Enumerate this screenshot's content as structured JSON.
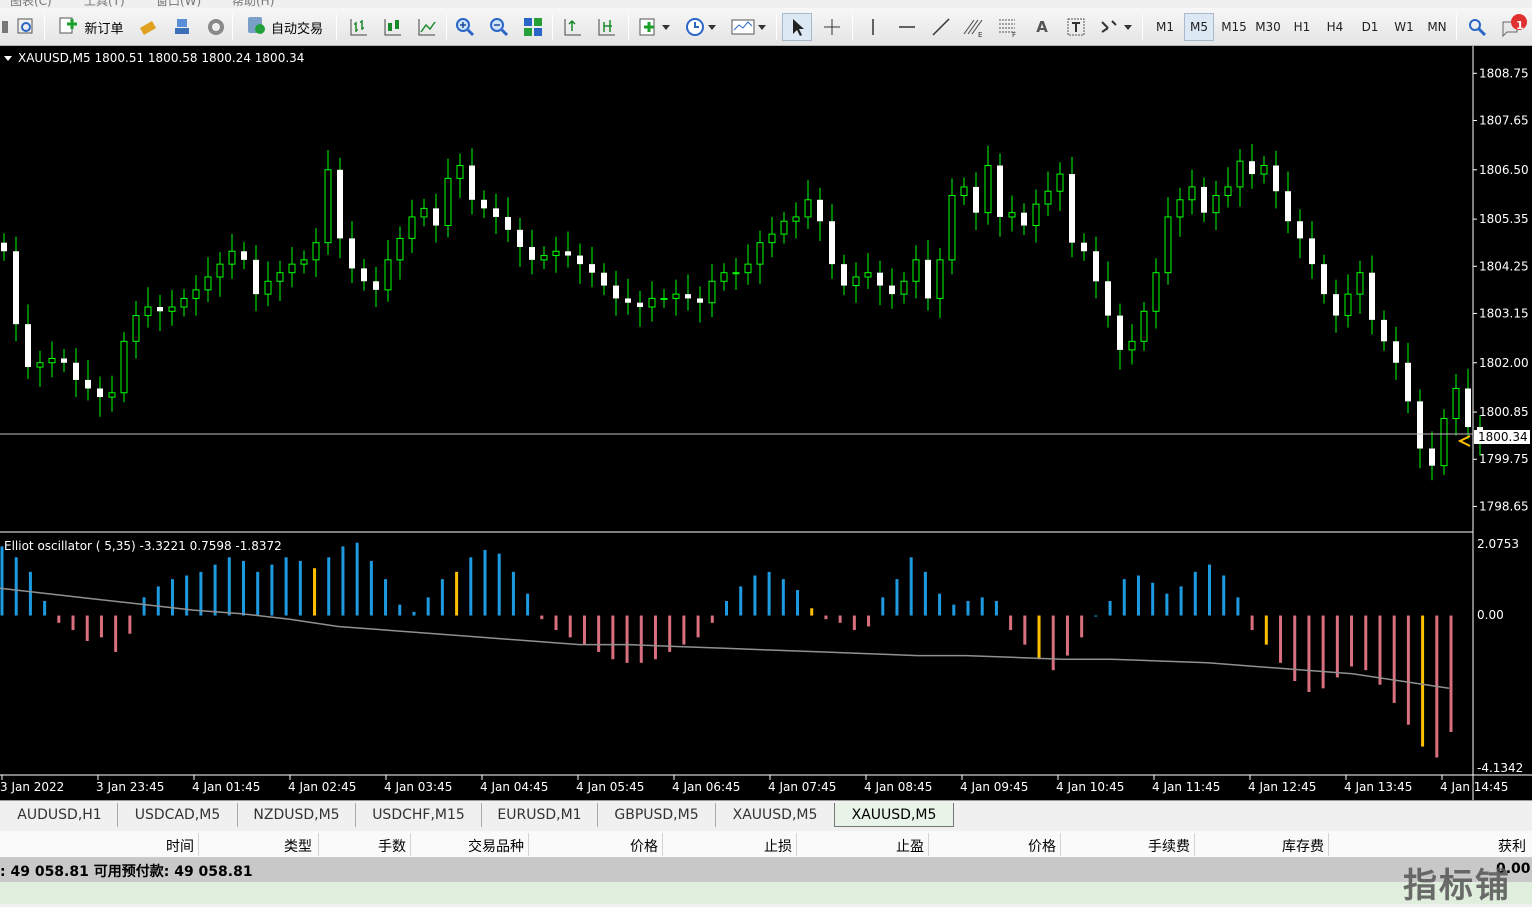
{
  "menu": [
    "图表(C)",
    "工具(T)",
    "窗口(W)",
    "帮助(H)"
  ],
  "toolbar": {
    "new_order": "新订单",
    "auto_trade": "自动交易",
    "timeframes": [
      "M1",
      "M5",
      "M15",
      "M30",
      "H1",
      "H4",
      "D1",
      "W1",
      "MN"
    ],
    "active_timeframe": "M5",
    "text_tool": "A",
    "notification_count": "1",
    "icons": [
      "chart-properties-icon",
      "zoom-to-fit-icon",
      "new-order-icon",
      "market-watch-icon",
      "navigator-icon",
      "signals-icon",
      "auto-trading-icon",
      "bar-chart-icon",
      "candle-chart-icon",
      "line-chart-icon",
      "zoom-in-icon",
      "zoom-out-icon",
      "tile-windows-icon",
      "chart-shift-icon",
      "autoscroll-icon",
      "indicators-icon",
      "periods-icon",
      "templates-icon",
      "cursor-icon",
      "crosshair-icon",
      "vertical-line-icon",
      "horizontal-line-icon",
      "trendline-icon",
      "fibonacci-icon",
      "grid-icon",
      "text-icon",
      "text-label-icon",
      "arrows-icon",
      "search-icon",
      "notification-icon"
    ]
  },
  "chart": {
    "symbol_info": "XAUUSD,M5  1800.51 1800.58 1800.24 1800.34",
    "current_price": "1800.34",
    "price_labels": [
      "1808.75",
      "1807.65",
      "1806.50",
      "1805.35",
      "1804.25",
      "1803.15",
      "1802.00",
      "1800.85",
      "1799.75",
      "1798.65"
    ],
    "indicator_info": "Elliot oscillator ( 5,35) -3.3221 0.7598 -1.8372",
    "indicator_labels": [
      "2.0753",
      "0.00",
      "-4.1342"
    ],
    "time_labels": [
      "3 Jan 2022",
      "3 Jan 23:45",
      "4 Jan 01:45",
      "4 Jan 02:45",
      "4 Jan 03:45",
      "4 Jan 04:45",
      "4 Jan 05:45",
      "4 Jan 06:45",
      "4 Jan 07:45",
      "4 Jan 08:45",
      "4 Jan 09:45",
      "4 Jan 10:45",
      "4 Jan 11:45",
      "4 Jan 12:45",
      "4 Jan 13:45",
      "4 Jan 14:45"
    ],
    "colors": {
      "background": "#000000",
      "candle": "#00ff00",
      "osc_up": "#1e9be0",
      "osc_down": "#d8707f",
      "osc_signal": "#ffc000",
      "signal_line": "#909090"
    }
  },
  "chart_data": {
    "type": "candlestick",
    "price_ylim": [
      1798.1,
      1809.2
    ],
    "close": [
      1804.6,
      1802.9,
      1801.9,
      1802.0,
      1802.1,
      1802.0,
      1801.6,
      1801.4,
      1801.2,
      1801.3,
      1802.5,
      1803.1,
      1803.3,
      1803.2,
      1803.3,
      1803.5,
      1803.7,
      1804.0,
      1804.3,
      1804.6,
      1804.4,
      1803.6,
      1803.9,
      1804.1,
      1804.3,
      1804.4,
      1804.8,
      1806.5,
      1804.9,
      1804.2,
      1803.9,
      1803.7,
      1804.4,
      1804.9,
      1805.4,
      1805.6,
      1805.2,
      1806.3,
      1806.6,
      1805.8,
      1805.6,
      1805.4,
      1805.1,
      1804.7,
      1804.4,
      1804.5,
      1804.6,
      1804.5,
      1804.3,
      1804.1,
      1803.8,
      1803.5,
      1803.4,
      1803.3,
      1803.5,
      1803.5,
      1803.6,
      1803.5,
      1803.4,
      1803.9,
      1804.1,
      1804.1,
      1804.3,
      1804.8,
      1805.0,
      1805.3,
      1805.4,
      1805.8,
      1805.3,
      1804.3,
      1803.8,
      1804.0,
      1804.1,
      1803.8,
      1803.6,
      1803.9,
      1804.4,
      1803.5,
      1804.4,
      1805.9,
      1806.1,
      1805.5,
      1806.6,
      1805.4,
      1805.5,
      1805.2,
      1805.7,
      1806.0,
      1806.4,
      1804.8,
      1804.6,
      1803.9,
      1803.1,
      1802.3,
      1802.5,
      1803.2,
      1804.1,
      1805.4,
      1805.8,
      1806.1,
      1805.5,
      1805.9,
      1806.1,
      1806.7,
      1806.4,
      1806.6,
      1806.0,
      1805.3,
      1804.9,
      1804.3,
      1803.6,
      1803.1,
      1803.6,
      1804.1,
      1803.0,
      1802.5,
      1802.0,
      1801.1,
      1800.0,
      1799.6,
      1800.7,
      1801.4,
      1800.5,
      1800.3
    ],
    "oscillator": [
      1.9,
      1.6,
      1.2,
      0.4,
      -0.2,
      -0.4,
      -0.7,
      -0.6,
      -1.0,
      -0.5,
      0.5,
      0.8,
      1.0,
      1.1,
      1.2,
      1.4,
      1.6,
      1.5,
      1.2,
      1.4,
      1.6,
      1.5,
      1.3,
      1.6,
      1.9,
      2.0,
      1.5,
      1.0,
      0.3,
      0.1,
      0.5,
      1.0,
      1.2,
      1.6,
      1.8,
      1.7,
      1.2,
      0.6,
      -0.1,
      -0.4,
      -0.6,
      -0.8,
      -1.0,
      -1.2,
      -1.3,
      -1.3,
      -1.2,
      -1.0,
      -0.8,
      -0.6,
      -0.2,
      0.4,
      0.8,
      1.1,
      1.2,
      1.0,
      0.7,
      0.2,
      -0.1,
      -0.2,
      -0.4,
      -0.3,
      0.5,
      1.0,
      1.6,
      1.2,
      0.6,
      0.3,
      0.4,
      0.5,
      0.4,
      -0.4,
      -0.8,
      -1.2,
      -1.5,
      -1.1,
      -0.6,
      0.0,
      0.4,
      1.0,
      1.1,
      0.9,
      0.6,
      0.8,
      1.2,
      1.4,
      1.1,
      0.5,
      -0.4,
      -0.8,
      -1.3,
      -1.8,
      -2.1,
      -2.0,
      -1.7,
      -1.4,
      -1.5,
      -1.9,
      -2.4,
      -3.0,
      -3.6,
      -3.9,
      -3.2
    ],
    "signal_line": [
      0.75,
      0.6,
      0.45,
      0.3,
      0.15,
      0.05,
      -0.1,
      -0.3,
      -0.4,
      -0.5,
      -0.6,
      -0.7,
      -0.8,
      -0.8,
      -0.85,
      -0.9,
      -0.95,
      -1.0,
      -1.05,
      -1.1,
      -1.1,
      -1.15,
      -1.2,
      -1.2,
      -1.25,
      -1.3,
      -1.4,
      -1.5,
      -1.6,
      -1.8,
      -2.0
    ],
    "ylim_osc": [
      -4.1342,
      2.0753
    ]
  }
}
